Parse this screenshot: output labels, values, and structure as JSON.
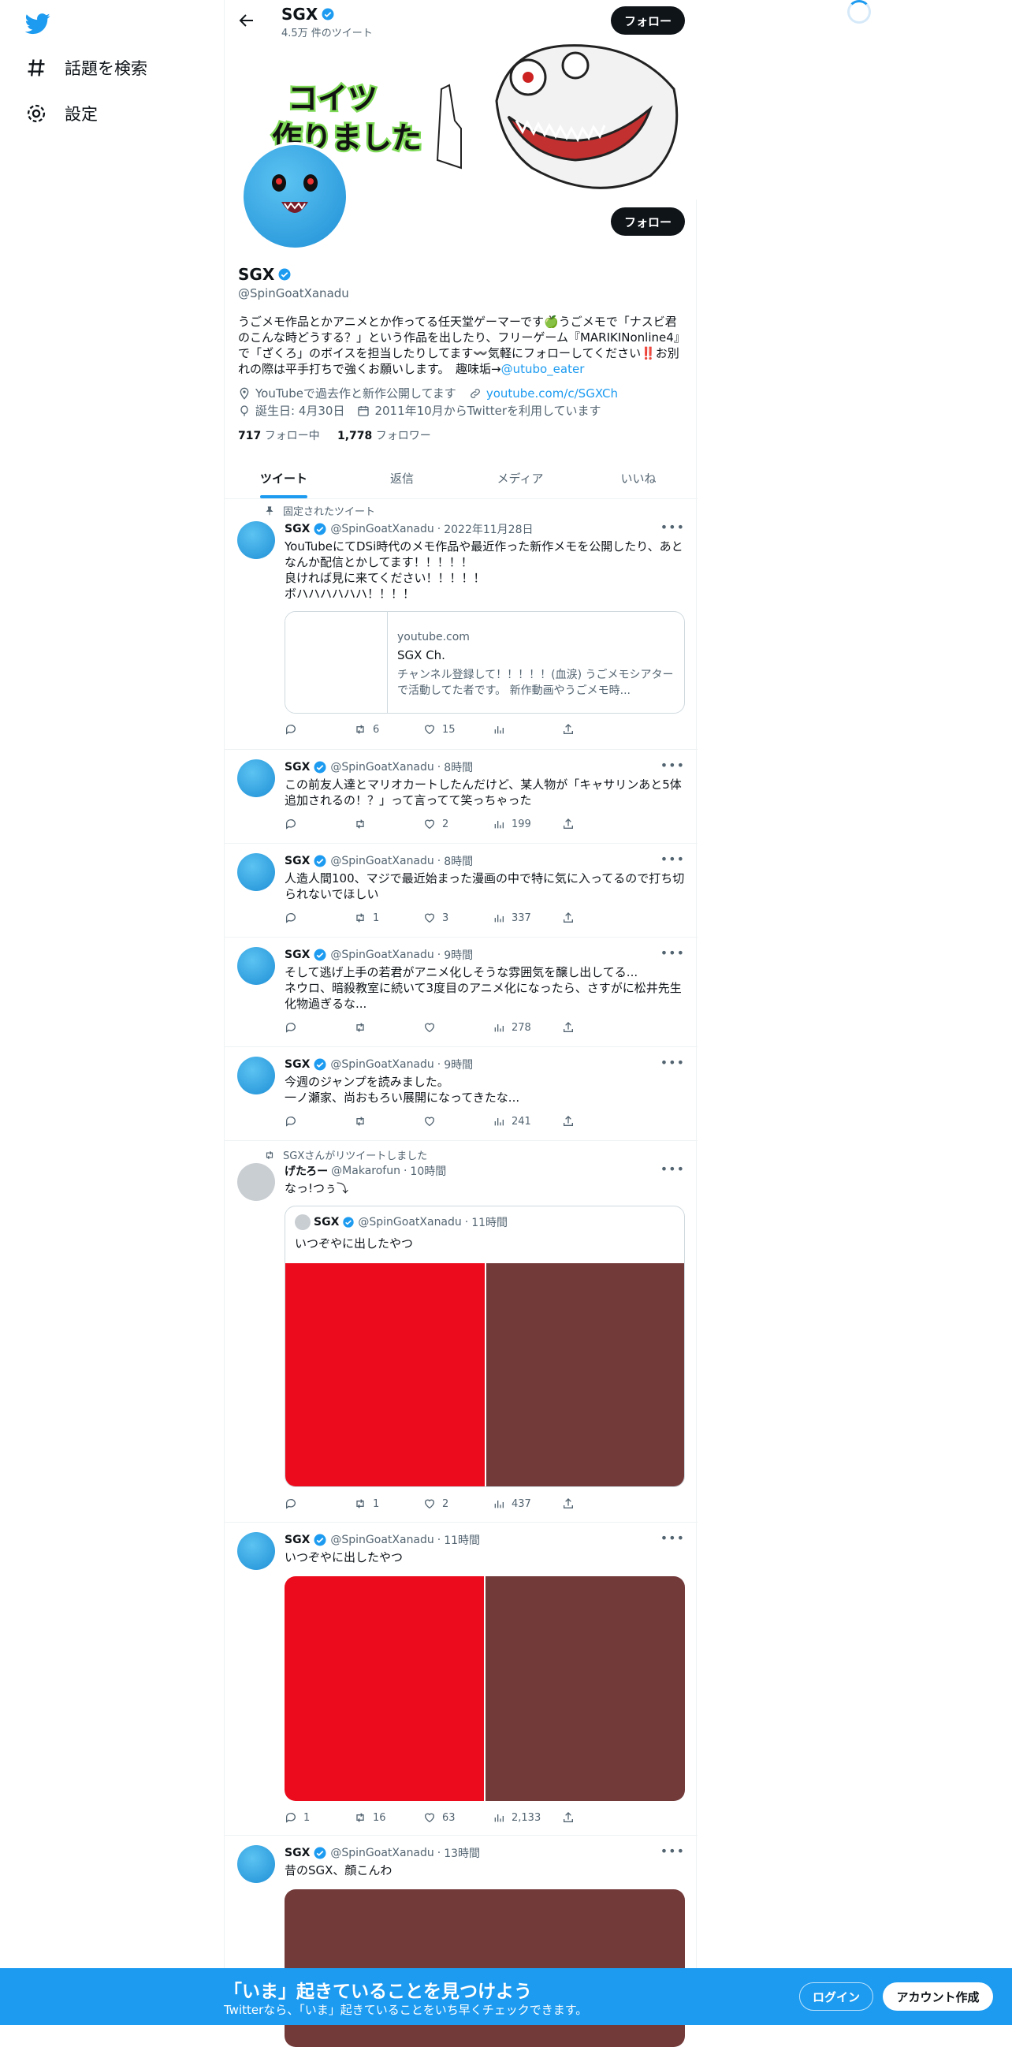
{
  "nav": {
    "explore_label": "話題を検索",
    "settings_label": "設定"
  },
  "header": {
    "name": "SGX",
    "tweet_count": "4.5万 件のツイート",
    "follow_label": "フォロー"
  },
  "banner": {
    "text_line1": "コイツ",
    "text_line2": "作りました"
  },
  "profile": {
    "name": "SGX",
    "handle": "@SpinGoatXanadu",
    "bio": "うごメモ作品とかアニメとか作ってる任天堂ゲーマーです🍏うごメモで「ナスビ君のこんな時どうする？」という作品を出したり、フリーゲーム『MARIKINonline4』で「ざくろ」のボイスを担当したりしてます〰️気軽にフォローしてください‼️お別れの際は平手打ちで強くお願いします。　趣味垢→",
    "bio_link": "@utubo_eater",
    "location": "YouTubeで過去作と新作公開してます",
    "website": "youtube.com/c/SGXCh",
    "birthday": "誕生日: 4月30日",
    "joined": "2011年10月からTwitterを利用しています",
    "following_count": "717",
    "following_label": "フォロー中",
    "followers_count": "1,778",
    "followers_label": "フォロワー",
    "follow_label": "フォロー"
  },
  "tabs": [
    "ツイート",
    "返信",
    "メディア",
    "いいね"
  ],
  "tweets": [
    {
      "context": "固定されたツイート",
      "name": "SGX",
      "handle": "@SpinGoatXanadu",
      "time": "2022年11月28日",
      "text": "YouTubeにてDSi時代のメモ作品や最近作った新作メモを公開したり、あとなんか配信とかしてます！！！！！\n良ければ見に来てください！！！！！\nボハハハハハハ！！！！",
      "card": {
        "domain": "youtube.com",
        "title": "SGX Ch.",
        "description": "チャンネル登録して！！！！！(血涙) うごメモシアターで活動してた者です。 新作動画やうごメモ時..."
      },
      "replies": "",
      "retweets": "6",
      "likes": "15",
      "views": ""
    },
    {
      "name": "SGX",
      "handle": "@SpinGoatXanadu",
      "time": "8時間",
      "text": "この前友人達とマリオカートしたんだけど、某人物が「キャサリンあと5体追加されるの！？」って言ってて笑っちゃった",
      "replies": "",
      "retweets": "",
      "likes": "2",
      "views": "199"
    },
    {
      "name": "SGX",
      "handle": "@SpinGoatXanadu",
      "time": "8時間",
      "text": "人造人間100、マジで最近始まった漫画の中で特に気に入ってるので打ち切られないでほしい",
      "replies": "",
      "retweets": "1",
      "likes": "3",
      "views": "337"
    },
    {
      "name": "SGX",
      "handle": "@SpinGoatXanadu",
      "time": "9時間",
      "text": "そして逃げ上手の若君がアニメ化しそうな雰囲気を醸し出してる...\nネウロ、暗殺教室に続いて3度目のアニメ化になったら、さすがに松井先生化物過ぎるな...",
      "replies": "",
      "retweets": "",
      "likes": "",
      "views": "278"
    },
    {
      "name": "SGX",
      "handle": "@SpinGoatXanadu",
      "time": "9時間",
      "text": "今週のジャンプを読みました。\n一ノ瀬家、尚おもろい展開になってきたな...",
      "replies": "",
      "retweets": "",
      "likes": "",
      "views": "241"
    },
    {
      "context": "SGXさんがリツイートしました",
      "name": "げたろー",
      "handle": "@Makarofun",
      "time": "10時間",
      "text": "なっ!つぅ⤵",
      "quote": {
        "name": "SGX",
        "handle": "@SpinGoatXanadu",
        "time": "11時間",
        "text": "いつぞやに出したやつ"
      },
      "replies": "",
      "retweets": "1",
      "likes": "2",
      "views": "437"
    },
    {
      "name": "SGX",
      "handle": "@SpinGoatXanadu",
      "time": "11時間",
      "text": "いつぞやに出したやつ",
      "replies": "1",
      "retweets": "16",
      "likes": "63",
      "views": "2,133"
    },
    {
      "name": "SGX",
      "handle": "@SpinGoatXanadu",
      "time": "13時間",
      "text": "昔のSGX、顔こんわ"
    }
  ],
  "bottom_bar": {
    "title": "「いま」起きていることを見つけよう",
    "subtitle": "Twitterなら、「いま」起きていることをいち早くチェックできます。",
    "login_label": "ログイン",
    "signup_label": "アカウント作成"
  },
  "colors": {
    "accent": "#1d9bf0",
    "text": "#0f1419",
    "muted": "#536471",
    "media_red": "#eb0b1c",
    "media_brown": "#733a3a"
  }
}
